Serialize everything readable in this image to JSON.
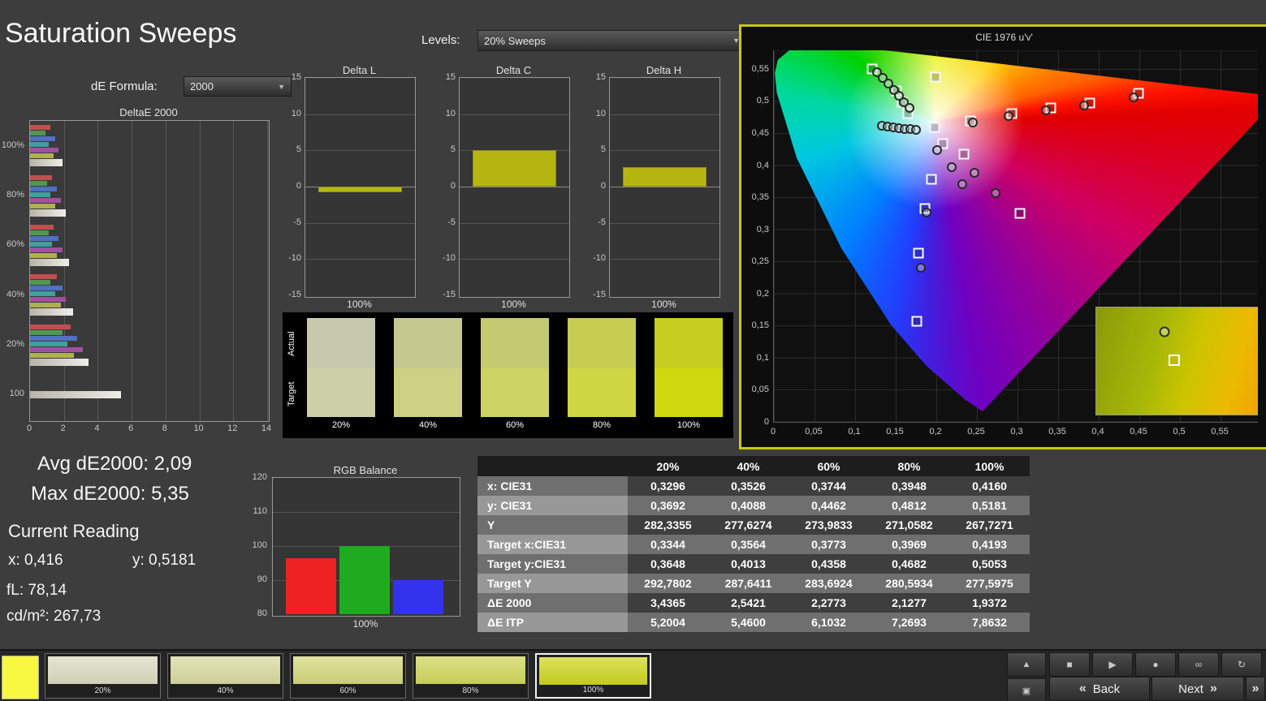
{
  "title": "Saturation Sweeps",
  "controls": {
    "de_formula_label": "dE Formula:",
    "de_formula_value": "2000",
    "levels_label": "Levels:",
    "levels_value": "20% Sweeps"
  },
  "stats": {
    "avg_de": "Avg dE2000: 2,09",
    "max_de": "Max dE2000: 5,35",
    "current_reading_label": "Current Reading",
    "x_value": "x: 0,416",
    "y_value": "y: 0,5181",
    "fl_value": "fL: 78,14",
    "cdm2_value": "cd/m²: 267,73"
  },
  "swatch_panel": {
    "row_labels": [
      "Actual",
      "Target"
    ],
    "items": [
      {
        "label": "20%",
        "actual": "#c6c9ac",
        "target": "#cdd0a6"
      },
      {
        "label": "40%",
        "actual": "#c6c98e",
        "target": "#cdd184"
      },
      {
        "label": "60%",
        "actual": "#c5ca70",
        "target": "#cdd364"
      },
      {
        "label": "80%",
        "actual": "#c6cd50",
        "target": "#ced644"
      },
      {
        "label": "100%",
        "actual": "#c6ce20",
        "target": "#d0d810"
      }
    ]
  },
  "table": {
    "columns": [
      "",
      "20%",
      "40%",
      "60%",
      "80%",
      "100%"
    ],
    "rows": [
      {
        "label": "x: CIE31",
        "values": [
          "0,3296",
          "0,3526",
          "0,3744",
          "0,3948",
          "0,4160"
        ]
      },
      {
        "label": "y: CIE31",
        "values": [
          "0,3692",
          "0,4088",
          "0,4462",
          "0,4812",
          "0,5181"
        ]
      },
      {
        "label": "Y",
        "values": [
          "282,3355",
          "277,6274",
          "273,9833",
          "271,0582",
          "267,7271"
        ]
      },
      {
        "label": "Target x:CIE31",
        "values": [
          "0,3344",
          "0,3564",
          "0,3773",
          "0,3969",
          "0,4193"
        ]
      },
      {
        "label": "Target y:CIE31",
        "values": [
          "0,3648",
          "0,4013",
          "0,4358",
          "0,4682",
          "0,5053"
        ]
      },
      {
        "label": "Target Y",
        "values": [
          "292,7802",
          "287,6411",
          "283,6924",
          "280,5934",
          "277,5975"
        ]
      },
      {
        "label": "ΔE 2000",
        "values": [
          "3,4365",
          "2,5421",
          "2,2773",
          "2,1277",
          "1,9372"
        ]
      },
      {
        "label": "ΔE ITP",
        "values": [
          "5,2004",
          "5,4600",
          "6,1032",
          "7,2693",
          "7,8632"
        ]
      }
    ]
  },
  "chart_data": [
    {
      "type": "bar",
      "title": "DeltaE 2000",
      "orientation": "horizontal",
      "xlim": [
        0,
        14
      ],
      "x_ticks": [
        0,
        2,
        4,
        6,
        8,
        10,
        12,
        14
      ],
      "bar_colors": [
        "#c05050",
        "#509850",
        "#5070c0",
        "#40a0a0",
        "#a050a0",
        "#b0b050"
      ],
      "avg_color": "#d6d2c6",
      "groups": [
        {
          "label": "100%",
          "values": [
            1.2,
            0.9,
            1.5,
            1.1,
            1.7,
            1.4
          ],
          "avg": 1.94
        },
        {
          "label": "80%",
          "values": [
            1.3,
            1.0,
            1.6,
            1.2,
            1.8,
            1.5
          ],
          "avg": 2.13
        },
        {
          "label": "60%",
          "values": [
            1.4,
            1.1,
            1.7,
            1.3,
            1.9,
            1.6
          ],
          "avg": 2.28
        },
        {
          "label": "40%",
          "values": [
            1.6,
            1.2,
            1.9,
            1.5,
            2.1,
            1.8
          ],
          "avg": 2.54
        },
        {
          "label": "20%",
          "values": [
            2.4,
            1.9,
            2.8,
            2.2,
            3.1,
            2.6
          ],
          "avg": 3.44
        },
        {
          "label": "100",
          "values": [],
          "avg": 5.35
        }
      ]
    },
    {
      "type": "bar",
      "title": "Delta L",
      "ylim": [
        -15,
        15
      ],
      "y_ticks": [
        15,
        10,
        5,
        0,
        -5,
        -10,
        -15
      ],
      "xlabel": "100%",
      "categories": [
        "100%"
      ],
      "values": [
        -0.8
      ],
      "bar_color": "#b6b613"
    },
    {
      "type": "bar",
      "title": "Delta C",
      "ylim": [
        -15,
        15
      ],
      "y_ticks": [
        15,
        10,
        5,
        0,
        -5,
        -10,
        -15
      ],
      "xlabel": "100%",
      "categories": [
        "100%"
      ],
      "values": [
        5.0
      ],
      "bar_color": "#b6b613"
    },
    {
      "type": "bar",
      "title": "Delta H",
      "ylim": [
        -15,
        15
      ],
      "y_ticks": [
        15,
        10,
        5,
        0,
        -5,
        -10,
        -15
      ],
      "xlabel": "100%",
      "categories": [
        "100%"
      ],
      "values": [
        2.7
      ],
      "bar_color": "#b6b613"
    },
    {
      "type": "bar",
      "title": "RGB Balance",
      "ylim": [
        80,
        120
      ],
      "y_ticks": [
        120,
        110,
        100,
        90,
        80
      ],
      "xlabel": "100%",
      "categories": [
        "Red",
        "Green",
        "Blue"
      ],
      "values": [
        96.5,
        100,
        90
      ],
      "colors": [
        "#ee2222",
        "#1faa1f",
        "#3333ee"
      ]
    },
    {
      "type": "scatter",
      "title": "CIE 1976 u'v'",
      "xlim": [
        0,
        0.596
      ],
      "ylim": [
        0,
        0.579
      ],
      "x_ticks": [
        "0",
        "0,05",
        "0,1",
        "0,15",
        "0,2",
        "0,25",
        "0,3",
        "0,35",
        "0,4",
        "0,45",
        "0,5",
        "0,55"
      ],
      "y_ticks": [
        "0,55",
        "0,5",
        "0,45",
        "0,4",
        "0,35",
        "0,3",
        "0,25",
        "0,2",
        "0,15",
        "0,1",
        "0,05",
        "0"
      ],
      "targets": [
        [
          0.121,
          0.55
        ],
        [
          0.199,
          0.537
        ],
        [
          0.151,
          0.516
        ],
        [
          0.158,
          0.498
        ],
        [
          0.165,
          0.481
        ],
        [
          0.449,
          0.512
        ],
        [
          0.389,
          0.497
        ],
        [
          0.341,
          0.489
        ],
        [
          0.293,
          0.48
        ],
        [
          0.242,
          0.469
        ],
        [
          0.198,
          0.459
        ],
        [
          0.208,
          0.434
        ],
        [
          0.234,
          0.417
        ],
        [
          0.194,
          0.378
        ],
        [
          0.186,
          0.333
        ],
        [
          0.303,
          0.325
        ],
        [
          0.178,
          0.263
        ],
        [
          0.176,
          0.157
        ]
      ],
      "measurements": [
        [
          0.127,
          0.545
        ],
        [
          0.134,
          0.536
        ],
        [
          0.141,
          0.527
        ],
        [
          0.148,
          0.517
        ],
        [
          0.154,
          0.508
        ],
        [
          0.16,
          0.498
        ],
        [
          0.167,
          0.489
        ],
        [
          0.133,
          0.461
        ],
        [
          0.14,
          0.46
        ],
        [
          0.147,
          0.459
        ],
        [
          0.154,
          0.458
        ],
        [
          0.161,
          0.457
        ],
        [
          0.168,
          0.456
        ],
        [
          0.175,
          0.455
        ],
        [
          0.443,
          0.506
        ],
        [
          0.382,
          0.493
        ],
        [
          0.335,
          0.486
        ],
        [
          0.289,
          0.477
        ],
        [
          0.245,
          0.467
        ],
        [
          0.201,
          0.423
        ],
        [
          0.219,
          0.397
        ],
        [
          0.247,
          0.388
        ],
        [
          0.273,
          0.357
        ],
        [
          0.188,
          0.326
        ],
        [
          0.232,
          0.371
        ],
        [
          0.181,
          0.24
        ]
      ]
    }
  ],
  "toolbar": {
    "color_chip": "#f8f840",
    "swatches": [
      {
        "label": "20%",
        "color": "#dadcc0",
        "selected": false
      },
      {
        "label": "40%",
        "color": "#d7da9e",
        "selected": false
      },
      {
        "label": "60%",
        "color": "#d3d87a",
        "selected": false
      },
      {
        "label": "80%",
        "color": "#d0d75a",
        "selected": false
      },
      {
        "label": "100%",
        "color": "#cdd51f",
        "selected": true
      }
    ],
    "side_buttons": [
      {
        "name": "chevron-up",
        "glyph": "▲"
      },
      {
        "name": "layout",
        "glyph": "▣"
      }
    ],
    "media_buttons": [
      {
        "name": "stop",
        "glyph": "■"
      },
      {
        "name": "play",
        "glyph": "▶"
      },
      {
        "name": "record",
        "glyph": "●"
      },
      {
        "name": "continuous",
        "glyph": "∞"
      },
      {
        "name": "loop",
        "glyph": "↻"
      }
    ],
    "back_symbol": "«",
    "back_label": "Back",
    "next_label": "Next",
    "next_symbol": "»",
    "fast_forward_symbol": "»"
  }
}
